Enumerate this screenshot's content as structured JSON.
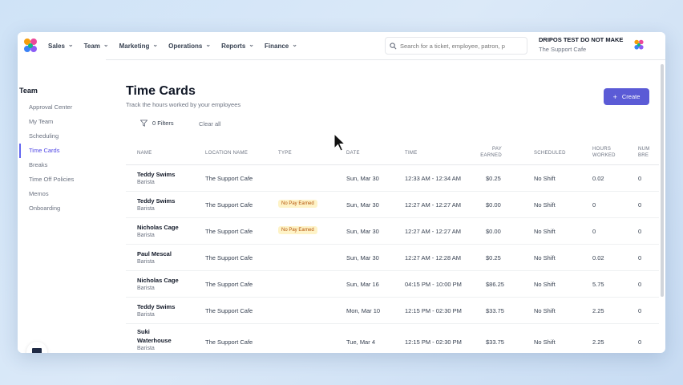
{
  "nav": {
    "items": [
      {
        "label": "Sales"
      },
      {
        "label": "Team"
      },
      {
        "label": "Marketing"
      },
      {
        "label": "Operations"
      },
      {
        "label": "Reports"
      },
      {
        "label": "Finance"
      }
    ],
    "search_placeholder": "Search for a ticket, employee, patron, p",
    "account_title": "DRIPOS TEST DO NOT MAKE",
    "account_sub": "The Support Cafe"
  },
  "sidebar": {
    "title": "Team",
    "items": [
      {
        "label": "Approval Center",
        "active": false
      },
      {
        "label": "My Team",
        "active": false
      },
      {
        "label": "Scheduling",
        "active": false
      },
      {
        "label": "Time Cards",
        "active": true
      },
      {
        "label": "Breaks",
        "active": false
      },
      {
        "label": "Time Off Policies",
        "active": false
      },
      {
        "label": "Memos",
        "active": false
      },
      {
        "label": "Onboarding",
        "active": false
      }
    ]
  },
  "page": {
    "title": "Time Cards",
    "subtitle": "Track the hours worked by your employees",
    "create_label": "Create",
    "filters_label": "0 Filters",
    "clear_label": "Clear all"
  },
  "table": {
    "headers": [
      "NAME",
      "LOCATION NAME",
      "TYPE",
      "DATE",
      "TIME",
      "PAY EARNED",
      "SCHEDULED",
      "HOURS WORKED",
      "NUM BRE"
    ],
    "rows": [
      {
        "name": "Teddy Swims",
        "role": "Barista",
        "location": "The Support Cafe",
        "type": "",
        "date": "Sun, Mar 30",
        "time": "12:33 AM - 12:34 AM",
        "pay": "$0.25",
        "scheduled": "No Shift",
        "hours": "0.02",
        "breaks": "0"
      },
      {
        "name": "Teddy Swims",
        "role": "Barista",
        "location": "The Support Cafe",
        "type": "No Pay Earned",
        "date": "Sun, Mar 30",
        "time": "12:27 AM - 12:27 AM",
        "pay": "$0.00",
        "scheduled": "No Shift",
        "hours": "0",
        "breaks": "0"
      },
      {
        "name": "Nicholas Cage",
        "role": "Barista",
        "location": "The Support Cafe",
        "type": "No Pay Earned",
        "date": "Sun, Mar 30",
        "time": "12:27 AM - 12:27 AM",
        "pay": "$0.00",
        "scheduled": "No Shift",
        "hours": "0",
        "breaks": "0"
      },
      {
        "name": "Paul Mescal",
        "role": "Barista",
        "location": "The Support Cafe",
        "type": "",
        "date": "Sun, Mar 30",
        "time": "12:27 AM - 12:28 AM",
        "pay": "$0.25",
        "scheduled": "No Shift",
        "hours": "0.02",
        "breaks": "0"
      },
      {
        "name": "Nicholas Cage",
        "role": "Barista",
        "location": "The Support Cafe",
        "type": "",
        "date": "Sun, Mar 16",
        "time": "04:15 PM - 10:00 PM",
        "pay": "$86.25",
        "scheduled": "No Shift",
        "hours": "5.75",
        "breaks": "0"
      },
      {
        "name": "Teddy Swims",
        "role": "Barista",
        "location": "The Support Cafe",
        "type": "",
        "date": "Mon, Mar 10",
        "time": "12:15 PM - 02:30 PM",
        "pay": "$33.75",
        "scheduled": "No Shift",
        "hours": "2.25",
        "breaks": "0"
      },
      {
        "name": "Suki Waterhouse",
        "role": "Barista",
        "location": "The Support Cafe",
        "type": "",
        "date": "Tue, Mar 4",
        "time": "12:15 PM - 02:30 PM",
        "pay": "$33.75",
        "scheduled": "No Shift",
        "hours": "2.25",
        "breaks": "0"
      }
    ]
  },
  "colors": {
    "accent": "#5b5bd6",
    "badge_bg": "#fef3c7",
    "badge_text": "#b45309"
  },
  "icons": {
    "logo": "dripos-logo-icon",
    "search": "search-icon",
    "filter": "filter-icon",
    "chat": "chat-icon",
    "cursor": "mouse-cursor-icon"
  }
}
